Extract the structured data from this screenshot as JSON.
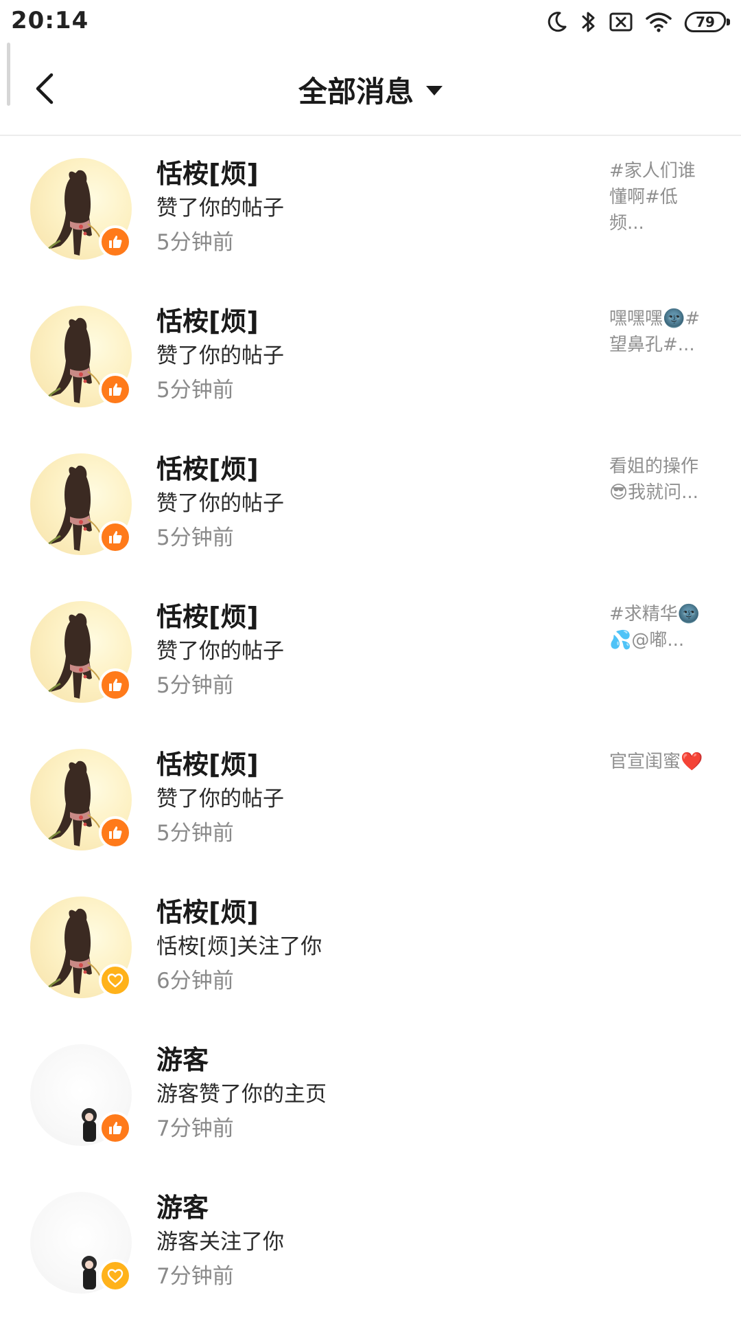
{
  "status_bar": {
    "time": "20:14",
    "icons": [
      "moon-icon",
      "bluetooth-icon",
      "no-sim-icon",
      "wifi-icon",
      "battery-icon"
    ],
    "battery_level": "79"
  },
  "header": {
    "title": "全部消息",
    "back_icon": "chevron-left-icon",
    "dropdown_icon": "caret-down-icon"
  },
  "colors": {
    "like_badge": "#ff7a1a",
    "follow_badge": "#ffb21a",
    "secondary_text": "#8a8a8a"
  },
  "messages": [
    {
      "name": "恬桉[烦]",
      "action": "赞了你的帖子",
      "time": "5分钟前",
      "preview": "#家人们谁懂啊#低频...",
      "badge": "thumbs-up-icon",
      "avatar": "user-avatar"
    },
    {
      "name": "恬桉[烦]",
      "action": "赞了你的帖子",
      "time": "5分钟前",
      "preview": "嘿嘿嘿🌚#望鼻孔#...",
      "badge": "thumbs-up-icon",
      "avatar": "user-avatar"
    },
    {
      "name": "恬桉[烦]",
      "action": "赞了你的帖子",
      "time": "5分钟前",
      "preview": "看姐的操作😎我就问...",
      "badge": "thumbs-up-icon",
      "avatar": "user-avatar"
    },
    {
      "name": "恬桉[烦]",
      "action": "赞了你的帖子",
      "time": "5分钟前",
      "preview": "#求精华🌚💦@嘟...",
      "badge": "thumbs-up-icon",
      "avatar": "user-avatar"
    },
    {
      "name": "恬桉[烦]",
      "action": "赞了你的帖子",
      "time": "5分钟前",
      "preview": "官宣闺蜜❤️",
      "badge": "thumbs-up-icon",
      "avatar": "user-avatar"
    },
    {
      "name": "恬桉[烦]",
      "action": "恬桉[烦]关注了你",
      "time": "6分钟前",
      "preview": "",
      "badge": "heart-icon",
      "avatar": "user-avatar"
    },
    {
      "name": "游客",
      "action": "游客赞了你的主页",
      "time": "7分钟前",
      "preview": "",
      "badge": "thumbs-up-icon",
      "avatar": "guest-avatar"
    },
    {
      "name": "游客",
      "action": "游客关注了你",
      "time": "7分钟前",
      "preview": "",
      "badge": "heart-icon",
      "avatar": "guest-avatar"
    }
  ]
}
